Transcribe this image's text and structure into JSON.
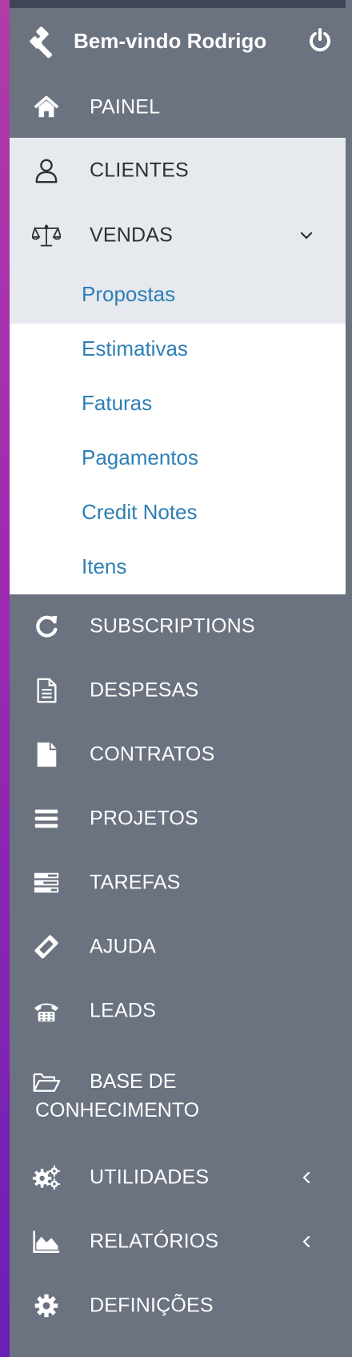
{
  "profile": {
    "greeting": "Bem-vindo Rodrigo"
  },
  "nav": {
    "painel": "PAINEL",
    "clientes": "CLIENTES",
    "vendas": "VENDAS",
    "subscriptions": "SUBSCRIPTIONS",
    "despesas": "DESPESAS",
    "contratos": "CONTRATOS",
    "projetos": "PROJETOS",
    "tarefas": "TAREFAS",
    "ajuda": "AJUDA",
    "leads": "LEADS",
    "base_line1": "BASE DE",
    "base_line2": "CONHECIMENTO",
    "utilidades": "UTILIDADES",
    "relatorios": "RELATÓRIOS",
    "definicoes": "DEFINIÇÕES"
  },
  "vendas_submenu": {
    "propostas": "Propostas",
    "estimativas": "Estimativas",
    "faturas": "Faturas",
    "pagamentos": "Pagamentos",
    "credit_notes": "Credit Notes",
    "itens": "Itens"
  },
  "icons": {
    "profile": "gavel-icon",
    "logout": "power-icon",
    "painel": "home-icon",
    "clientes": "user-icon",
    "vendas": "balance-scale-icon",
    "subscriptions": "refresh-icon",
    "despesas": "file-text-icon",
    "contratos": "file-icon",
    "projetos": "bars-icon",
    "tarefas": "tasks-icon",
    "ajuda": "ticket-icon",
    "leads": "phone-icon",
    "base": "folder-open-icon",
    "utilidades": "cogs-icon",
    "relatorios": "area-chart-icon",
    "definicoes": "cog-icon"
  },
  "colors": {
    "sidebar_bg": "#6b7280",
    "active_bg": "#e6eaee",
    "submenu_link": "#2e7fb5",
    "accent_edge": "#9c2ab0"
  }
}
